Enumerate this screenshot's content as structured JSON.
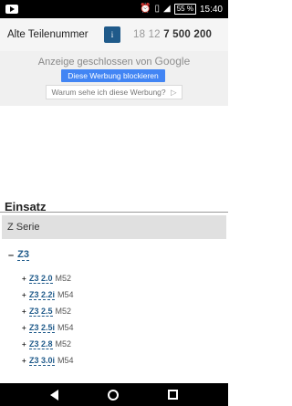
{
  "status_bar": {
    "battery": "55 %",
    "time": "15:40"
  },
  "part_row": {
    "label": "Alte Teilenummer",
    "info_button": "i",
    "number_prefix": "18 12",
    "number_main": "7 500 200"
  },
  "ad": {
    "closed_text": "Anzeige geschlossen von",
    "brand": "Google",
    "block_label": "Diese Werbung blockieren",
    "why_label": "Warum sehe ich diese Werbung?",
    "why_icon": "ad-choices-icon"
  },
  "einsatz": {
    "heading": "Einsatz",
    "serie": "Z Serie",
    "group": {
      "toggle": "–",
      "label": "Z3"
    },
    "models": [
      {
        "name": "Z3 2.0",
        "engine": "M52"
      },
      {
        "name": "Z3 2.2i",
        "engine": "M54"
      },
      {
        "name": "Z3 2.5",
        "engine": "M52"
      },
      {
        "name": "Z3 2.5i",
        "engine": "M54"
      },
      {
        "name": "Z3 2.8",
        "engine": "M52"
      },
      {
        "name": "Z3 3.0i",
        "engine": "M54"
      }
    ]
  }
}
